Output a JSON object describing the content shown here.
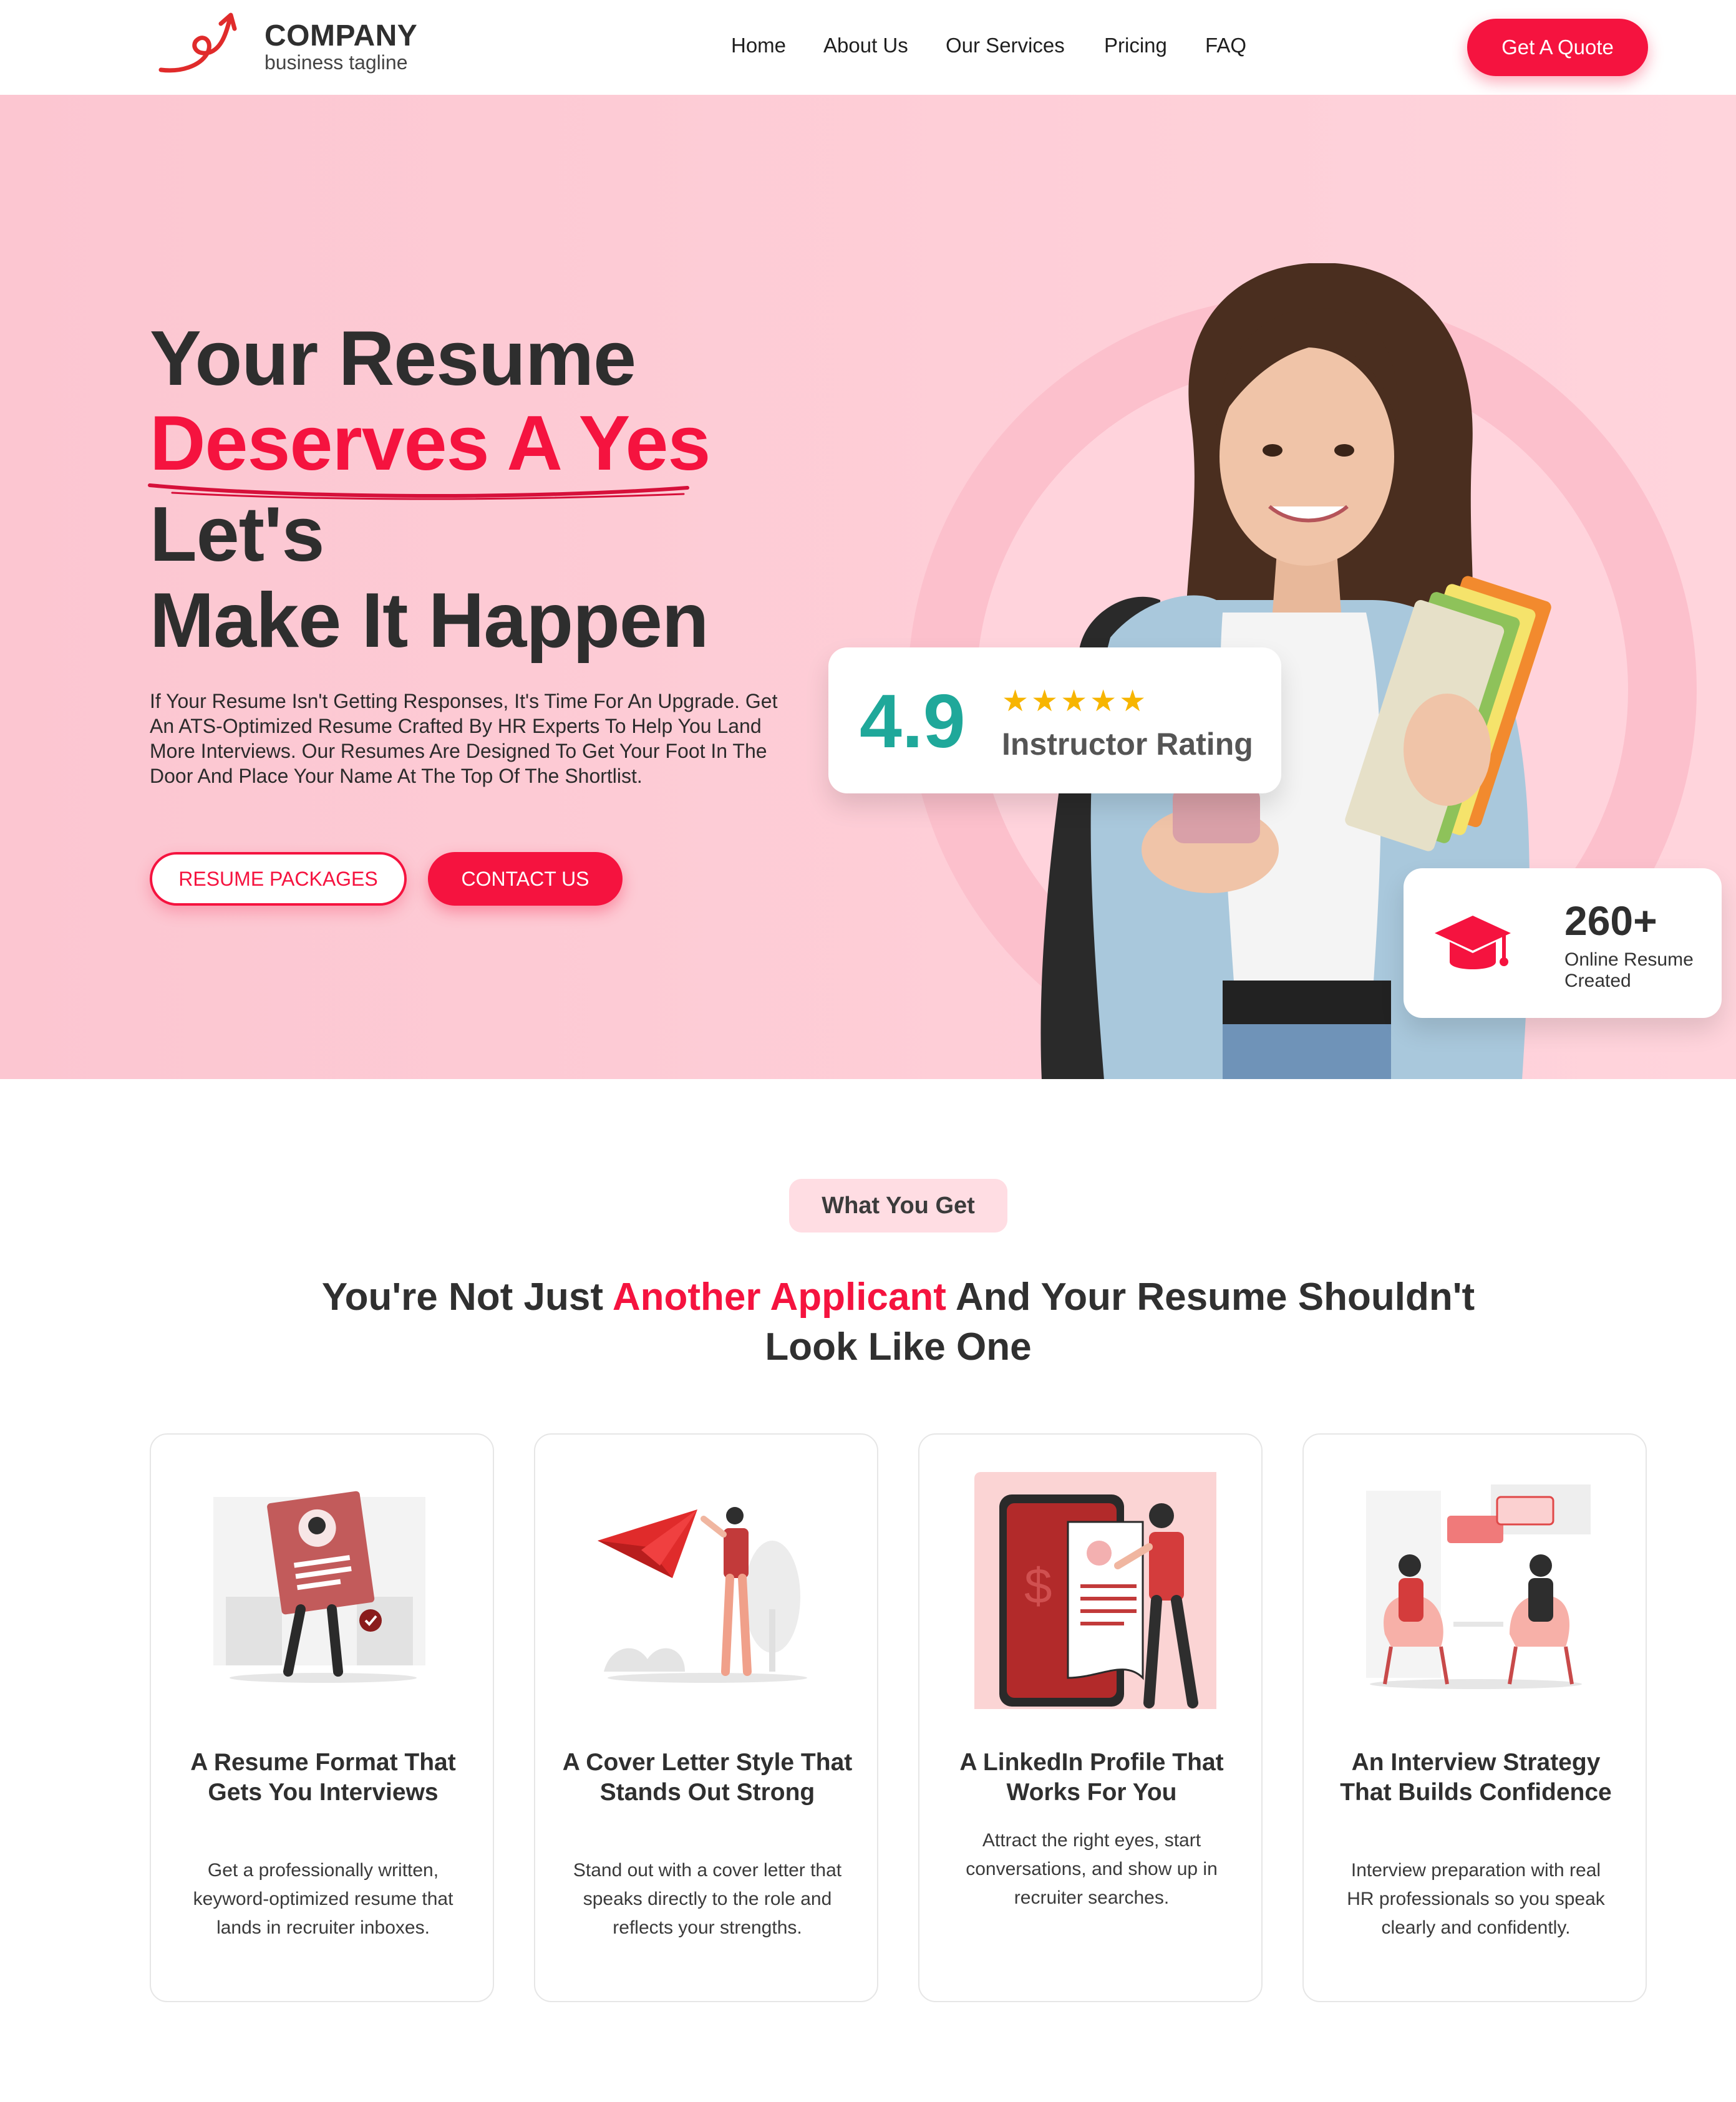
{
  "header": {
    "brand_name": "COMPANY",
    "brand_tagline": "business tagline",
    "nav": [
      "Home",
      "About Us",
      "Our Services",
      "Pricing",
      "FAQ"
    ],
    "cta_label": "Get A Quote"
  },
  "hero": {
    "line1": "Your Resume",
    "line2": "Deserves A Yes",
    "line3": "Let's",
    "line4": "Make It Happen",
    "description": "If Your Resume Isn't Getting Responses, It's Time For An Upgrade. Get An ATS-Optimized Resume Crafted By HR Experts To Help You Land More Interviews. Our Resumes Are Designed To Get Your Foot In The Door And Place Your Name At The Top Of The Shortlist.",
    "btn_packages": "RESUME PACKAGES",
    "btn_contact": "CONTACT US",
    "rating": {
      "value": "4.9",
      "stars": "★★★★★",
      "label": "Instructor Rating"
    },
    "stat": {
      "value": "260+",
      "label": "Online Resume Created"
    }
  },
  "features": {
    "pill": "What You Get",
    "title_pre": "You're Not Just ",
    "title_accent": "Another Applicant",
    "title_post": " And Your Resume Shouldn't Look Like One",
    "cards": [
      {
        "title": "A Resume Format That Gets You Interviews",
        "body": "Get a professionally written, keyword-optimized resume that lands in recruiter inboxes."
      },
      {
        "title": "A Cover Letter Style That Stands Out Strong",
        "body": "Stand out with a cover letter that speaks directly to the role and reflects your strengths."
      },
      {
        "title": "A LinkedIn Profile That Works For You",
        "body": "Attract the right eyes, start conversations, and show up in recruiter searches."
      },
      {
        "title": "An Interview Strategy That Builds Confidence",
        "body": "Interview preparation with real HR professionals so you speak clearly and confidently."
      }
    ]
  },
  "colors": {
    "accent": "#f5133f",
    "teal": "#1fa89a",
    "star": "#f7b500",
    "hero_bg": "#ffd0d9"
  }
}
